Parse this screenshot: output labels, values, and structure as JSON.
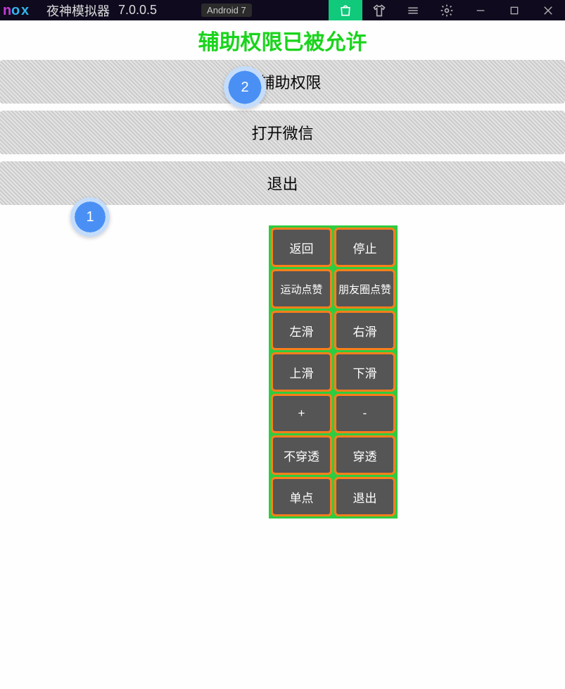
{
  "titlebar": {
    "app_name": "夜神模拟器",
    "app_version": "7.0.0.5",
    "android_badge": "Android 7"
  },
  "status_text": "辅助权限已被允许",
  "main_buttons": {
    "grant": "取辅助权限",
    "open_wechat": "打开微信",
    "exit": "退出"
  },
  "markers": {
    "m1": "1",
    "m2": "2"
  },
  "float_panel": [
    [
      "返回",
      "停止"
    ],
    [
      "运动点赞",
      "朋友圈点赞"
    ],
    [
      "左滑",
      "右滑"
    ],
    [
      "上滑",
      "下滑"
    ],
    [
      "+",
      "-"
    ],
    [
      "不穿透",
      "穿透"
    ],
    [
      "单点",
      "退出"
    ]
  ]
}
